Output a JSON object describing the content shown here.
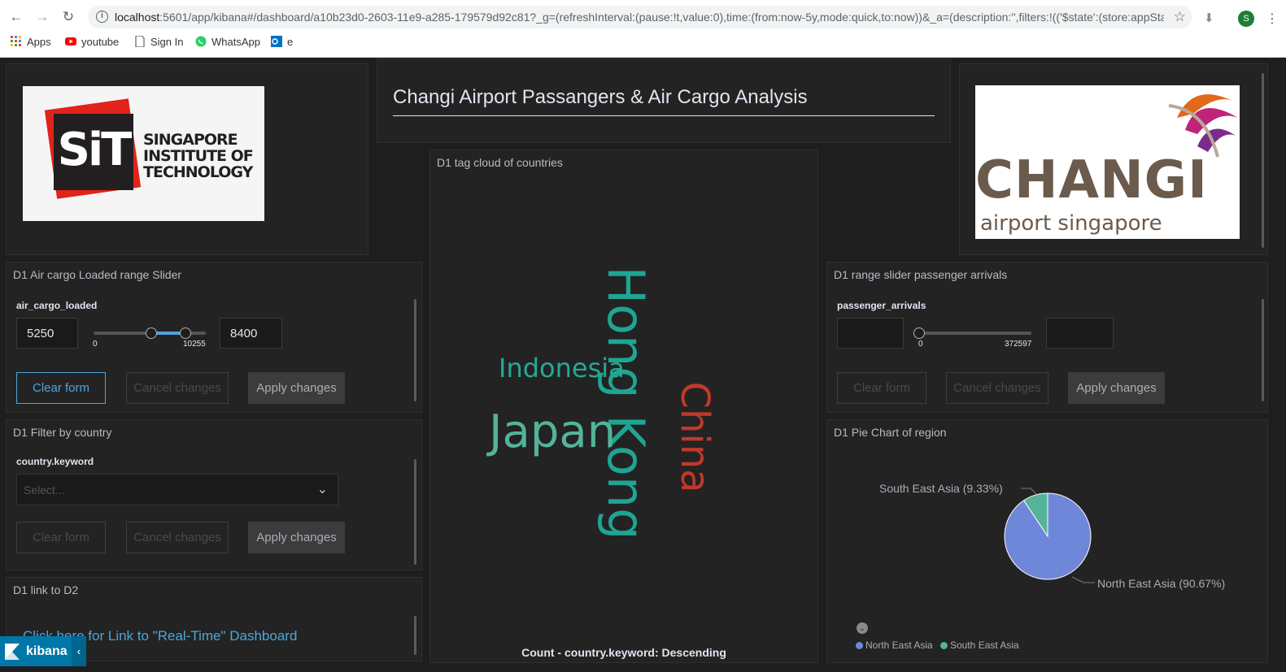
{
  "browser": {
    "url_host": "localhost",
    "url_rest": ":5601/app/kibana#/dashboard/a10b23d0-2603-11e9-a285-179579d92c81?_g=(refreshInterval:(pause:!t,value:0),time:(from:now-5y,mode:quick,to:now))&_a=(description:'',filters:!(('$state':(store:appSta...",
    "profile_initial": "S",
    "bookmarks": [
      "Apps",
      "youtube",
      "Sign In",
      "WhatsApp",
      "e"
    ]
  },
  "header": {
    "title": "Changi Airport Passangers & Air Cargo Analysis"
  },
  "logos": {
    "sit_mark": "SiT",
    "sit_line1": "SINGAPORE",
    "sit_line2": "INSTITUTE OF",
    "sit_line3": "TECHNOLOGY",
    "changi_word": "CHANGI",
    "changi_sub": "airport singapore"
  },
  "cargo_slider": {
    "title": "D1 Air cargo Loaded range Slider",
    "field": "air_cargo_loaded",
    "min_value": "5250",
    "max_value": "8400",
    "range_min": "0",
    "range_max": "10255",
    "low_fraction": 0.512,
    "high_fraction": 0.819,
    "clear": "Clear form",
    "cancel": "Cancel changes",
    "apply": "Apply changes"
  },
  "country_filter": {
    "title": "D1 Filter by country",
    "field": "country.keyword",
    "placeholder": "Select...",
    "clear": "Clear form",
    "cancel": "Cancel changes",
    "apply": "Apply changes"
  },
  "link_panel": {
    "title": "D1 link to D2",
    "link_text": "Click here for Link to \"Real-Time\" Dashboard"
  },
  "tag_cloud": {
    "title": "D1 tag cloud of countries",
    "footer": "Count - country.keyword: Descending",
    "words": [
      {
        "text": "Hong Kong",
        "color": "#1ea593"
      },
      {
        "text": "Japan",
        "color": "#54b399"
      },
      {
        "text": "China",
        "color": "#d36086"
      },
      {
        "text": "Indonesia",
        "color": "#27a892"
      }
    ]
  },
  "arrivals_slider": {
    "title": "D1 range slider passenger arrivals",
    "field": "passenger_arrivals",
    "range_min": "0",
    "range_max": "372597",
    "clear": "Clear form",
    "cancel": "Cancel changes",
    "apply": "Apply changes"
  },
  "chart_data": {
    "type": "pie",
    "title": "D1 Pie Chart of region",
    "slices": [
      {
        "name": "North East Asia",
        "percent": 90.67,
        "label": "North East Asia (90.67%)",
        "color": "#6f87d8"
      },
      {
        "name": "South East Asia",
        "percent": 9.33,
        "label": "South East Asia (9.33%)",
        "color": "#54b399"
      }
    ],
    "legend": [
      "North East Asia",
      "South East Asia"
    ],
    "legend_position": "bottom"
  },
  "kibana": {
    "label": "kibana",
    "collapse_glyph": "‹"
  }
}
